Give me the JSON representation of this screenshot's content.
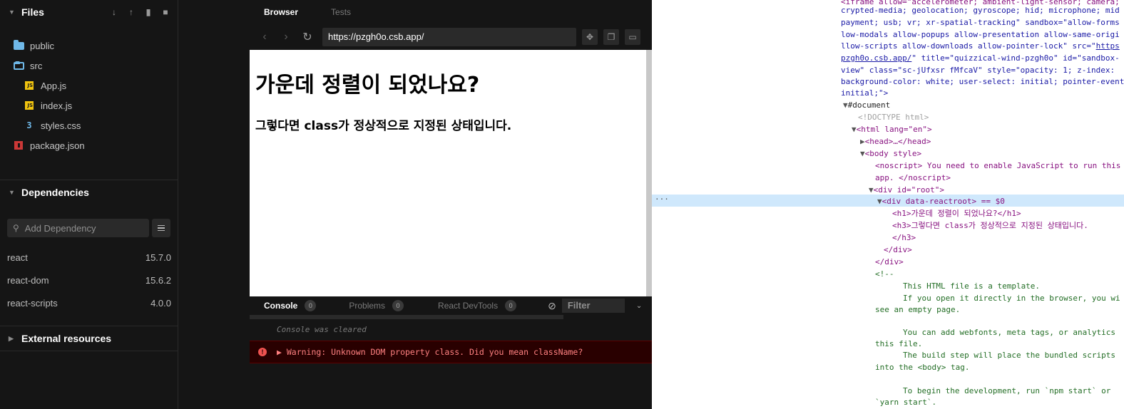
{
  "sidebar": {
    "files_title": "Files",
    "tree": [
      {
        "name": "public",
        "icon": "folder-icon"
      },
      {
        "name": "src",
        "icon": "folder-open-icon"
      },
      {
        "name": "App.js",
        "icon": "js-file-icon"
      },
      {
        "name": "index.js",
        "icon": "js-file-icon"
      },
      {
        "name": "styles.css",
        "icon": "css-file-icon"
      },
      {
        "name": "package.json",
        "icon": "npm-icon"
      }
    ],
    "dependencies_title": "Dependencies",
    "add_dependency_placeholder": "Add Dependency",
    "dependencies": [
      {
        "name": "react",
        "version": "15.7.0"
      },
      {
        "name": "react-dom",
        "version": "15.6.2"
      },
      {
        "name": "react-scripts",
        "version": "4.0.0"
      }
    ],
    "external_title": "External resources"
  },
  "browser": {
    "tab_browser": "Browser",
    "tab_tests": "Tests",
    "url": "https://pzgh0o.csb.app/",
    "page_h1": "가운데 정렬이 되었나요?",
    "page_h3": "그렇다면 class가 정상적으로 지정된 상태입니다."
  },
  "console": {
    "tab_console": "Console",
    "console_count": "0",
    "tab_problems": "Problems",
    "problems_count": "0",
    "tab_devtools": "React DevTools",
    "devtools_count": "0",
    "filter_placeholder": "Filter",
    "cleared": "Console was cleared",
    "warning": "▶ Warning: Unknown DOM property class. Did you mean className?"
  },
  "devtools": {
    "l1": "<iframe allow=\"accelerometer; ambient-light-sensor; camera;",
    "l2": "crypted-media; geolocation; gyroscope; hid; microphone; mid",
    "l3": "payment; usb; vr; xr-spatial-tracking\" sandbox=\"allow-forms",
    "l4": "low-modals allow-popups allow-presentation allow-same-origi",
    "l5": "llow-scripts allow-downloads allow-pointer-lock\" src=\"",
    "l5_link": "https",
    "l6_link": "pzgh0o.csb.app/",
    "l6": "\" title=\"quizzical-wind-pzgh0o\" id=\"sandbox-",
    "l7": "view\" class=\"sc-jUfxsr fMfcaV\" style=\"opacity: 1; z-index: ",
    "l8": "background-color: white; user-select: initial; pointer-event",
    "l9": "initial;\">",
    "doc": "#document",
    "doctype": "<!DOCTYPE html>",
    "html_open": "<html lang=\"en\">",
    "head": "<head>…</head>",
    "body_open": "<body style>",
    "noscript1": "<noscript> You need to enable JavaScript to run this",
    "noscript2": "app. </noscript>",
    "root_div": "<div id=\"root\">",
    "reactroot": "<div data-reactroot> == $0",
    "h1_line": "<h1>가운데 정렬이 되었나요?</h1>",
    "h3_line": "<h3>그렇다면 class가 정상적으로 지정된 상태입니다.",
    "h3_close": "</h3>",
    "div_close1": "</div>",
    "div_close2": "</div>",
    "comment_open": "<!--",
    "c1": "This HTML file is a template.",
    "c2": "If you open it directly in the browser, you wi",
    "c3": "see an empty page.",
    "c4": "You can add webfonts, meta tags, or analytics",
    "c5": "this file.",
    "c6": "The build step will place the bundled scripts",
    "c7": "into the <body> tag.",
    "c8": "To begin the development, run `npm start` or",
    "c9": "`yarn start`."
  }
}
